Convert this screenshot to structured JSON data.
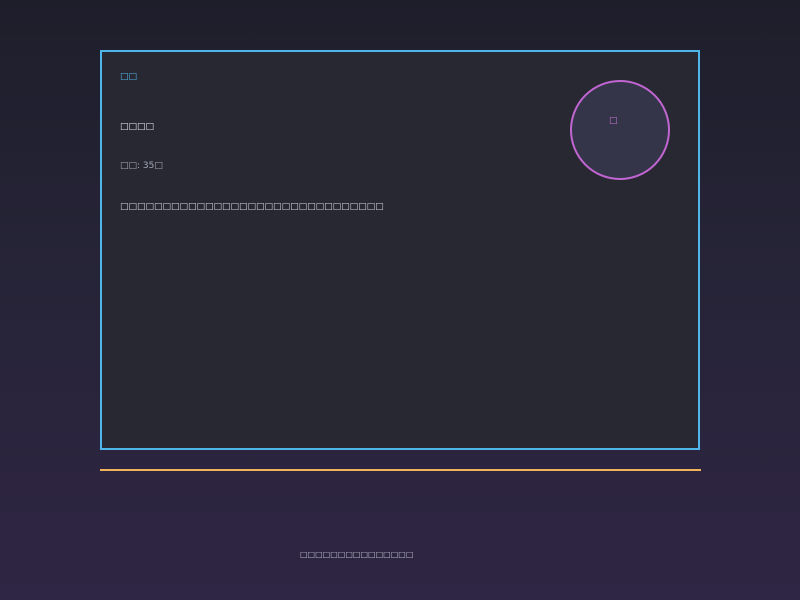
{
  "card": {
    "section_label": "□□",
    "heading": "□□□□",
    "meta": {
      "label": "□□",
      "value": "35□"
    },
    "description": "□□□□□□□□□□□□□□□□□□□□□□□□□□□□□□□"
  },
  "badge": {
    "label": "□"
  },
  "footer": {
    "text": "□□□□□□□□□□□□□□□"
  },
  "colors": {
    "card_border": "#4fb6ea",
    "badge_ring": "#c065d1",
    "divider": "#f0b35a"
  }
}
